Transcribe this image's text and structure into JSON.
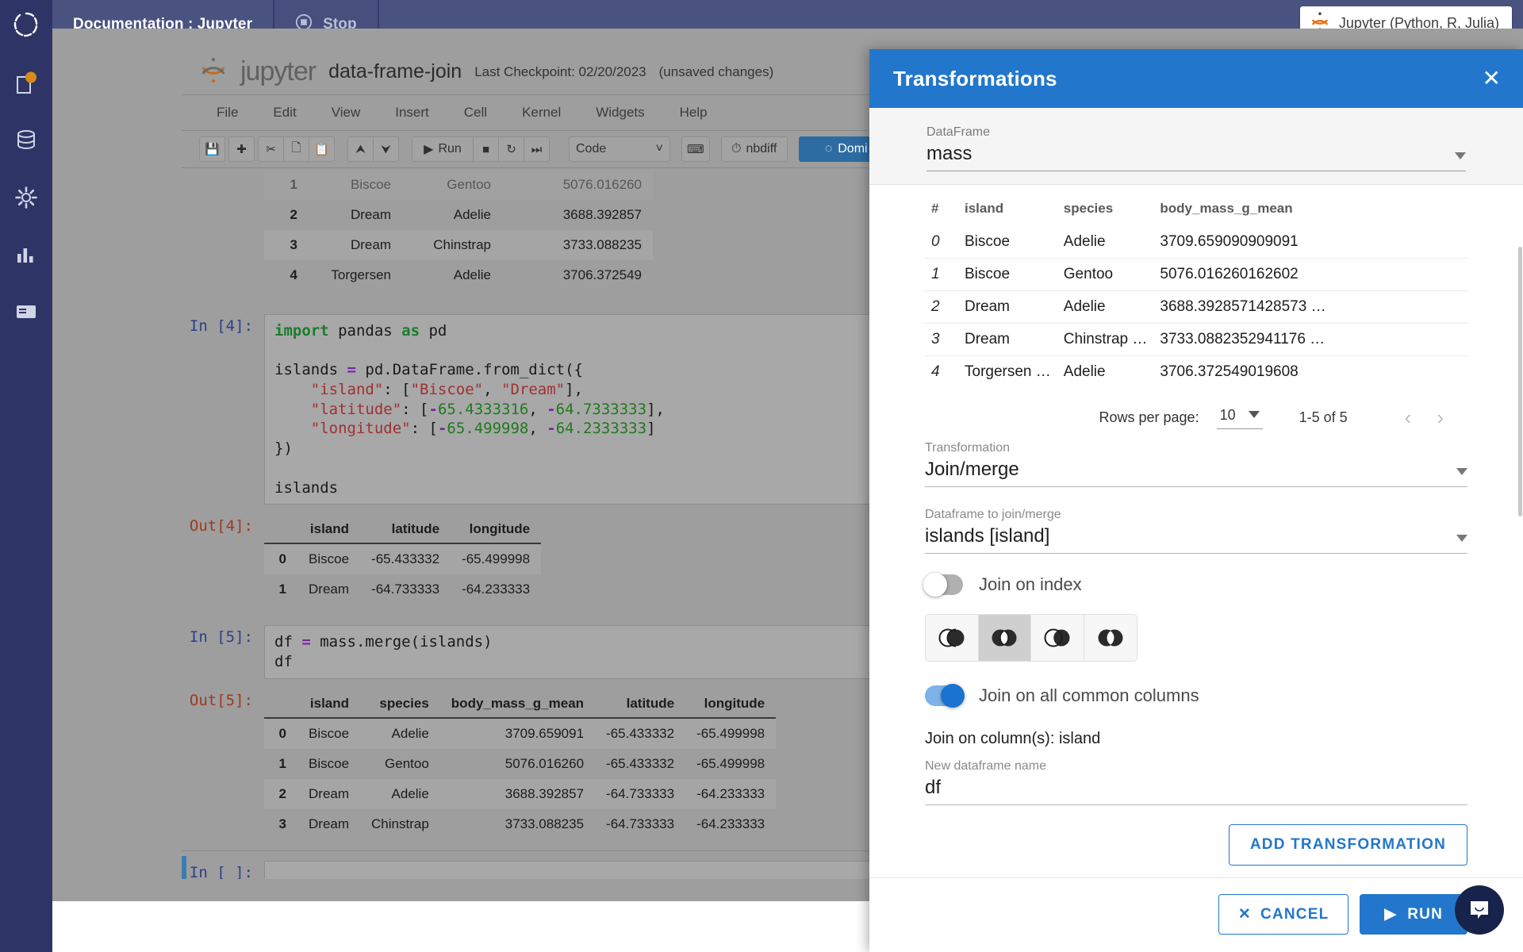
{
  "topbar": {
    "logo_icon": "domino-logo-icon",
    "tabs": [
      {
        "label": "Documentation : Jupyter",
        "name": "tab-documentation-jupyter"
      },
      {
        "label": "Stop",
        "name": "tab-stop",
        "icon": "stop-circle-icon"
      }
    ],
    "kernel_badge": {
      "label": "Jupyter (Python, R, Julia)",
      "icon": "jupyter-icon"
    },
    "bg_color": "#4a5280"
  },
  "rail": {
    "items": [
      {
        "name": "files-icon",
        "badge": true
      },
      {
        "name": "database-icon",
        "badge": false
      },
      {
        "name": "gear-icon",
        "badge": false
      },
      {
        "name": "chart-bar-icon",
        "badge": false
      },
      {
        "name": "card-icon",
        "badge": false
      }
    ],
    "badge_color": "#d98b17"
  },
  "notebook": {
    "brand": "jupyter",
    "name": "data-frame-join",
    "checkpoint": "Last Checkpoint: 02/20/2023",
    "unsaved": "(unsaved changes)",
    "menu": [
      "File",
      "Edit",
      "View",
      "Insert",
      "Cell",
      "Kernel",
      "Widgets",
      "Help"
    ],
    "toolbar": {
      "save": "save-icon",
      "add": "plus-icon",
      "cut": "scissors-icon",
      "copy": "copy-icon",
      "paste": "paste-icon",
      "move_up": "arrow-up-icon",
      "move_down": "arrow-down-icon",
      "run_label": "Run",
      "stop": "stop-square-icon",
      "restart": "restart-icon",
      "restart_run_all": "fast-forward-icon",
      "cell_type": "Code",
      "keyboard": "keyboard-icon",
      "nbdiff_label": "nbdiff",
      "domino_label": "Domi"
    },
    "top_table": {
      "rows": [
        {
          "idx": "1",
          "island": "Biscoe",
          "species": "Gentoo",
          "mass": "5076.016260"
        },
        {
          "idx": "2",
          "island": "Dream",
          "species": "Adelie",
          "mass": "3688.392857"
        },
        {
          "idx": "3",
          "island": "Dream",
          "species": "Chinstrap",
          "mass": "3733.088235"
        },
        {
          "idx": "4",
          "island": "Torgersen",
          "species": "Adelie",
          "mass": "3706.372549"
        }
      ]
    },
    "cell4": {
      "prompt": "In [4]:",
      "code_lines": [
        [
          {
            "t": "import",
            "c": "kw"
          },
          {
            "t": " pandas ",
            "c": ""
          },
          {
            "t": "as",
            "c": "kw"
          },
          {
            "t": " pd",
            "c": ""
          }
        ],
        [],
        [
          {
            "t": "islands ",
            "c": ""
          },
          {
            "t": "=",
            "c": "op"
          },
          {
            "t": " pd.DataFrame.from_dict({",
            "c": ""
          }
        ],
        [
          {
            "t": "    ",
            "c": ""
          },
          {
            "t": "\"island\"",
            "c": "str"
          },
          {
            "t": ": [",
            "c": ""
          },
          {
            "t": "\"Biscoe\"",
            "c": "str"
          },
          {
            "t": ", ",
            "c": ""
          },
          {
            "t": "\"Dream\"",
            "c": "str"
          },
          {
            "t": "],",
            "c": ""
          }
        ],
        [
          {
            "t": "    ",
            "c": ""
          },
          {
            "t": "\"latitude\"",
            "c": "str"
          },
          {
            "t": ": [",
            "c": ""
          },
          {
            "t": "-",
            "c": "op"
          },
          {
            "t": "65.4333316",
            "c": "num"
          },
          {
            "t": ", ",
            "c": ""
          },
          {
            "t": "-",
            "c": "op"
          },
          {
            "t": "64.7333333",
            "c": "num"
          },
          {
            "t": "],",
            "c": ""
          }
        ],
        [
          {
            "t": "    ",
            "c": ""
          },
          {
            "t": "\"longitude\"",
            "c": "str"
          },
          {
            "t": ": [",
            "c": ""
          },
          {
            "t": "-",
            "c": "op"
          },
          {
            "t": "65.499998",
            "c": "num"
          },
          {
            "t": ", ",
            "c": ""
          },
          {
            "t": "-",
            "c": "op"
          },
          {
            "t": "64.2333333",
            "c": "num"
          },
          {
            "t": "]",
            "c": ""
          }
        ],
        [
          {
            "t": "})",
            "c": ""
          }
        ],
        [],
        [
          {
            "t": "islands",
            "c": ""
          }
        ]
      ]
    },
    "out4": {
      "prompt": "Out[4]:",
      "headers": [
        "",
        "island",
        "latitude",
        "longitude"
      ],
      "rows": [
        {
          "idx": "0",
          "island": "Biscoe",
          "latitude": "-65.433332",
          "longitude": "-65.499998"
        },
        {
          "idx": "1",
          "island": "Dream",
          "latitude": "-64.733333",
          "longitude": "-64.233333"
        }
      ]
    },
    "cell5": {
      "prompt": "In [5]:",
      "code_lines": [
        [
          {
            "t": "df ",
            "c": ""
          },
          {
            "t": "=",
            "c": "op"
          },
          {
            "t": " mass.merge(islands)",
            "c": ""
          }
        ],
        [
          {
            "t": "df",
            "c": ""
          }
        ]
      ]
    },
    "out5": {
      "prompt": "Out[5]:",
      "headers": [
        "",
        "island",
        "species",
        "body_mass_g_mean",
        "latitude",
        "longitude"
      ],
      "rows": [
        {
          "idx": "0",
          "island": "Biscoe",
          "species": "Adelie",
          "mass": "3709.659091",
          "latitude": "-65.433332",
          "longitude": "-65.499998"
        },
        {
          "idx": "1",
          "island": "Biscoe",
          "species": "Gentoo",
          "mass": "5076.016260",
          "latitude": "-65.433332",
          "longitude": "-65.499998"
        },
        {
          "idx": "2",
          "island": "Dream",
          "species": "Adelie",
          "mass": "3688.392857",
          "latitude": "-64.733333",
          "longitude": "-64.233333"
        },
        {
          "idx": "3",
          "island": "Dream",
          "species": "Chinstrap",
          "mass": "3733.088235",
          "latitude": "-64.733333",
          "longitude": "-64.233333"
        }
      ]
    },
    "cell_empty": {
      "prompt": "In [ ]:",
      "code": ""
    }
  },
  "dialog": {
    "title": "Transformations",
    "close_icon": "close-icon",
    "header_color": "#2277cc",
    "dataframe": {
      "label": "DataFrame",
      "value": "mass"
    },
    "preview": {
      "headers": [
        "#",
        "island",
        "species",
        "body_mass_g_mean"
      ],
      "rows": [
        {
          "idx": "0",
          "island": "Biscoe",
          "species": "Adelie",
          "mass": "3709.659090909091"
        },
        {
          "idx": "1",
          "island": "Biscoe",
          "species": "Gentoo",
          "mass": "5076.016260162602"
        },
        {
          "idx": "2",
          "island": "Dream",
          "species": "Adelie",
          "mass": "3688.3928571428573 …"
        },
        {
          "idx": "3",
          "island": "Dream",
          "species": "Chinstrap …",
          "mass": "3733.0882352941176 …"
        },
        {
          "idx": "4",
          "island": "Torgersen …",
          "species": "Adelie",
          "mass": "3706.372549019608"
        }
      ]
    },
    "pager": {
      "rows_per_page_label": "Rows per page:",
      "rows_per_page_value": "10",
      "range": "1-5 of 5",
      "prev_icon": "chevron-left-icon",
      "next_icon": "chevron-right-icon"
    },
    "transformation": {
      "label": "Transformation",
      "value": "Join/merge"
    },
    "join_dataframe": {
      "label": "Dataframe to join/merge",
      "value": "islands [island]"
    },
    "join_on_index": {
      "label": "Join on index",
      "on": false
    },
    "join_types": [
      {
        "name": "join-type-left-icon",
        "active": false
      },
      {
        "name": "join-type-outer-icon",
        "active": true
      },
      {
        "name": "join-type-right-icon",
        "active": false
      },
      {
        "name": "join-type-inner-icon",
        "active": false
      }
    ],
    "join_all_common": {
      "label": "Join on all common columns",
      "on": true
    },
    "join_on_columns": "Join on column(s): island",
    "new_dataframe": {
      "label": "New dataframe name",
      "value": "df"
    },
    "add_transformation_label": "ADD TRANSFORMATION",
    "cancel_label": "CANCEL",
    "run_label": "RUN",
    "chat_icon": "chat-bubble-icon"
  }
}
